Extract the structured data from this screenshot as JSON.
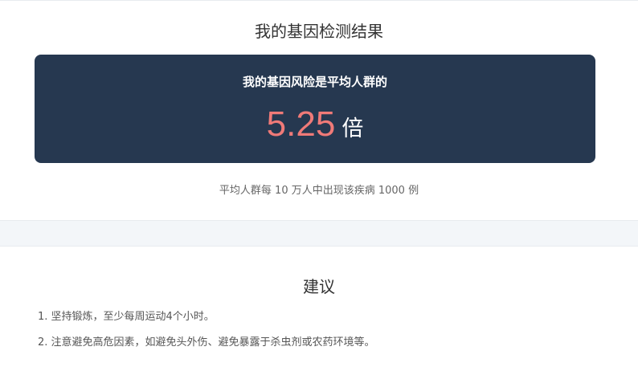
{
  "page_title": "我的基因检测结果",
  "risk": {
    "label": "我的基因风险是平均人群的",
    "value": "5.25",
    "unit": "倍",
    "value_color": "#f07a78",
    "panel_color": "#263850"
  },
  "baseline_note": "平均人群每 10 万人中出现该疾病 1000 例",
  "advice": {
    "title": "建议",
    "items": [
      "1. 坚持锻炼，至少每周运动4个小时。",
      "2. 注意避免高危因素，如避免头外伤、避免暴露于杀虫剂或农药环境等。"
    ]
  }
}
